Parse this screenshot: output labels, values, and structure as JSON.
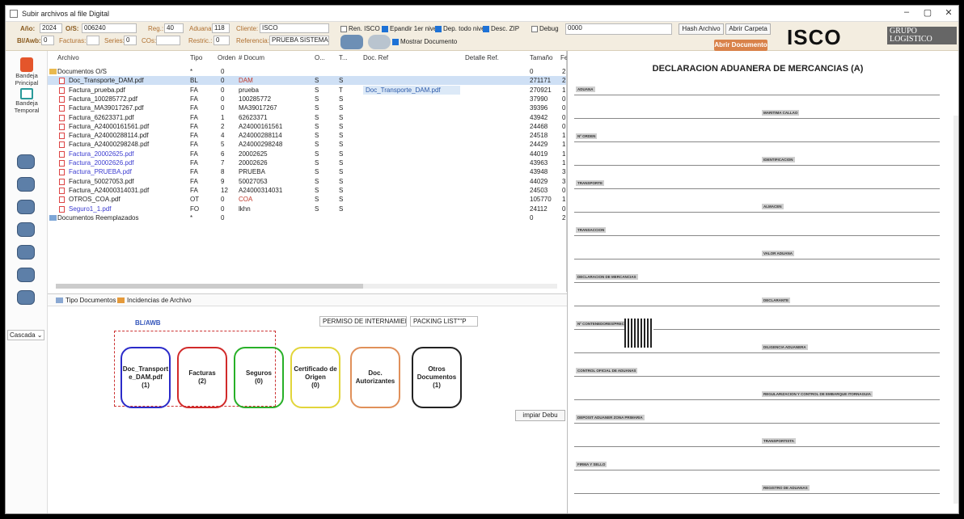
{
  "window": {
    "title": "Subir archivos al file Digital",
    "min": "–",
    "max": "▢",
    "close": "✕"
  },
  "toolbar": {
    "anio_label": "Año:",
    "anio": "2024",
    "os_label": "O/S:",
    "os": "006240",
    "reg_label": "Reg.:",
    "reg": "40",
    "aduana_label": "Aduana",
    "aduana": "118",
    "cliente_label": "Cliente:",
    "cliente": "ISCO",
    "blawb_label": "Bl/Awb:",
    "blawb": "0",
    "facturas_label": "Facturas:",
    "facturas": "",
    "series_label": "Series:",
    "series": "0",
    "cos_label": "COs:",
    "cos": "",
    "restric_label": "Restric.:",
    "restric": "0",
    "referencia_label": "Referencia:",
    "referencia": "PRUEBA SISTEMAS",
    "chk_ren_isco": "Ren. ISCO",
    "chk_expandir": "Epandir 1er nivel",
    "chk_dep": "Dep. todo nivel",
    "chk_desc": "Desc. ZIP",
    "chk_debug": "Debug",
    "chk_mostrar": "Mostrar Documento",
    "debug_value": "0000",
    "hash_btn": "Hash Archivo",
    "abrir_carpeta": "Abrir Carpeta",
    "abrir_documento": "Abrir Documento"
  },
  "logo": {
    "text": "ISCO",
    "sub": "GRUPO LOGISTICO"
  },
  "sidebar": {
    "bandeja_principal": "Bandeja Principal",
    "bandeja_temporal": "Bandeja Temporal",
    "cascade": "Cascada"
  },
  "grid": {
    "headers": [
      "Archivo",
      "Tipo",
      "Orden",
      "# Docum",
      "O...",
      "T...",
      "Doc. Ref",
      "Detalle Ref.",
      "Tamaño",
      "Fe"
    ],
    "rows": [
      {
        "archivo": "Documentos O/S",
        "tipo": "*",
        "orden": "0",
        "docum": "",
        "o": "",
        "t": "",
        "ref": "",
        "tam": "0",
        "fe": "2"
      },
      {
        "archivo": "Doc_Transporte_DAM.pdf",
        "tipo": "BL",
        "orden": "0",
        "docum": "DAM",
        "o": "S",
        "t": "S",
        "ref": "",
        "tam": "271171",
        "fe": "2"
      },
      {
        "archivo": "Factura_prueba.pdf",
        "tipo": "FA",
        "orden": "0",
        "docum": "prueba",
        "o": "S",
        "t": "T",
        "ref": "Doc_Transporte_DAM.pdf",
        "tam": "270921",
        "fe": "1"
      },
      {
        "archivo": "Factura_100285772.pdf",
        "tipo": "FA",
        "orden": "0",
        "docum": "100285772",
        "o": "S",
        "t": "S",
        "ref": "",
        "tam": "37990",
        "fe": "0"
      },
      {
        "archivo": "Factura_MA39017267.pdf",
        "tipo": "FA",
        "orden": "0",
        "docum": "MA39017267",
        "o": "S",
        "t": "S",
        "ref": "",
        "tam": "39396",
        "fe": "0"
      },
      {
        "archivo": "Factura_62623371.pdf",
        "tipo": "FA",
        "orden": "1",
        "docum": "62623371",
        "o": "S",
        "t": "S",
        "ref": "",
        "tam": "43942",
        "fe": "0"
      },
      {
        "archivo": "Factura_A24000161561.pdf",
        "tipo": "FA",
        "orden": "2",
        "docum": "A24000161561",
        "o": "S",
        "t": "S",
        "ref": "",
        "tam": "24468",
        "fe": "0"
      },
      {
        "archivo": "Factura_A24000288114.pdf",
        "tipo": "FA",
        "orden": "4",
        "docum": "A24000288114",
        "o": "S",
        "t": "S",
        "ref": "",
        "tam": "24518",
        "fe": "1"
      },
      {
        "archivo": "Factura_A24000298248.pdf",
        "tipo": "FA",
        "orden": "5",
        "docum": "A24000298248",
        "o": "S",
        "t": "S",
        "ref": "",
        "tam": "24429",
        "fe": "1"
      },
      {
        "archivo": "Factura_20002625.pdf",
        "tipo": "FA",
        "orden": "6",
        "docum": "20002625",
        "o": "S",
        "t": "S",
        "ref": "",
        "tam": "44019",
        "fe": "1"
      },
      {
        "archivo": "Factura_20002626.pdf",
        "tipo": "FA",
        "orden": "7",
        "docum": "20002626",
        "o": "S",
        "t": "S",
        "ref": "",
        "tam": "43963",
        "fe": "1"
      },
      {
        "archivo": "Factura_PRUEBA.pdf",
        "tipo": "FA",
        "orden": "8",
        "docum": "PRUEBA",
        "o": "S",
        "t": "S",
        "ref": "",
        "tam": "43948",
        "fe": "3"
      },
      {
        "archivo": "Factura_50027053.pdf",
        "tipo": "FA",
        "orden": "9",
        "docum": "50027053",
        "o": "S",
        "t": "S",
        "ref": "",
        "tam": "44029",
        "fe": "3"
      },
      {
        "archivo": "Factura_A24000314031.pdf",
        "tipo": "FA",
        "orden": "12",
        "docum": "A24000314031",
        "o": "S",
        "t": "S",
        "ref": "",
        "tam": "24503",
        "fe": "0"
      },
      {
        "archivo": "OTROS_COA.pdf",
        "tipo": "OT",
        "orden": "0",
        "docum": "COA",
        "o": "S",
        "t": "S",
        "ref": "",
        "tam": "105770",
        "fe": "1"
      },
      {
        "archivo": "Seguro1_1.pdf",
        "tipo": "FO",
        "orden": "0",
        "docum": "lkhn",
        "o": "S",
        "t": "S",
        "ref": "",
        "tam": "24112",
        "fe": "0"
      },
      {
        "archivo": "Documentos Reemplazados",
        "tipo": "*",
        "orden": "0",
        "docum": "",
        "o": "",
        "t": "",
        "ref": "",
        "tam": "0",
        "fe": "2"
      }
    ]
  },
  "tabs": {
    "tipo_documentos": "Tipo Documentos",
    "incidencias": "Incidencias de Archivo"
  },
  "panel": {
    "blawb_title": "BL/AWB",
    "permiso": "PERMISO DE INTERNAMIENT",
    "packing": "PACKING LIST\"\"P",
    "limpiar": "impiar Debu",
    "cards": [
      {
        "l1": "Doc_Transport",
        "l2": "e_DAM.pdf",
        "l3": "(1)",
        "color": "#2b2bc9"
      },
      {
        "l1": "Facturas",
        "l2": "(2)",
        "l3": "",
        "color": "#d12a2a"
      },
      {
        "l1": "Seguros",
        "l2": "(0)",
        "l3": "",
        "color": "#28b028"
      },
      {
        "l1": "Certificado de",
        "l2": "Origen",
        "l3": "(0)",
        "color": "#e2d53b"
      },
      {
        "l1": "Doc.",
        "l2": "Autorizantes",
        "l3": "",
        "color": "#e0905a"
      },
      {
        "l1": "Otros",
        "l2": "Documentos",
        "l3": "(1)",
        "color": "#222222"
      }
    ]
  },
  "doc": {
    "title": "DECLARACION ADUANERA DE MERCANCIAS (A)",
    "lines": [
      "ADUANA",
      "MARITIMA CALLAO",
      "Nº ORDEN",
      "IDENTIFICACION",
      "TRANSPORTE",
      "ALMACEN",
      "TRANSACCION",
      "VALOR ADUANA",
      "DECLARACION DE MERCANCIAS",
      "DECLARANTE",
      "Nº CONTENEDORES/PRECINTOS",
      "DILIGENCIA ADUANERA",
      "CONTROL OFICIAL DE ADUANAS",
      "REGULARIZACION Y CONTROL DE EMBARQUE ITORNAGUIA",
      "DEPOSIT ADUANER ZONA PRIMARIA",
      "TRANSPORTISTA",
      "FIRMA Y SELLO",
      "REGISTRO DE ADUANAS"
    ]
  }
}
